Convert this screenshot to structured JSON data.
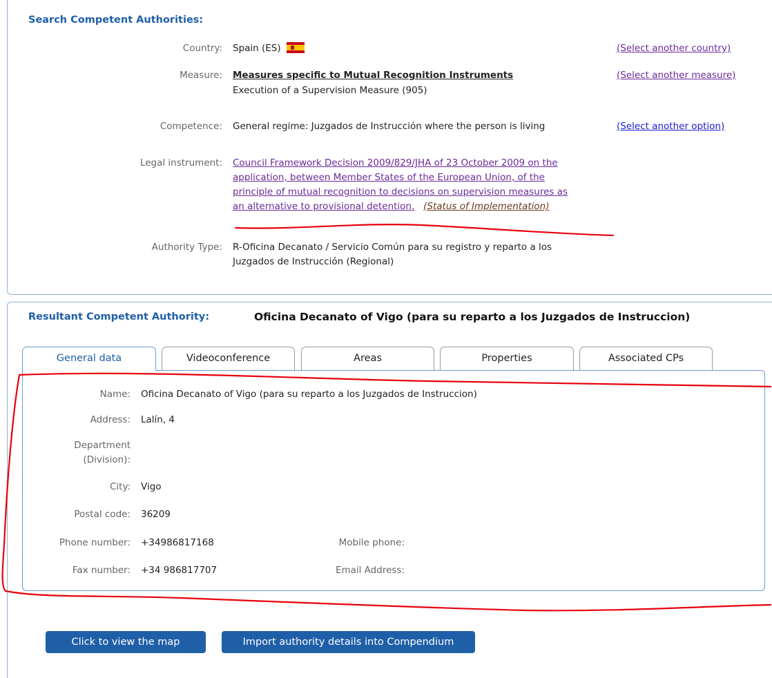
{
  "search": {
    "title": "Search Competent Authorities:",
    "country_label": "Country:",
    "country_value": "Spain (ES)",
    "country_link": "(Select another country)",
    "measure_label": "Measure:",
    "measure_title": "Measures specific to Mutual Recognition Instruments",
    "measure_sub": "Execution of a Supervision Measure (905)",
    "measure_link": "(Select another measure)",
    "competence_label": "Competence:",
    "competence_value": "General regime: Juzgados de Instrucción where the person is living",
    "competence_link": "(Select another option)",
    "legal_label": "Legal instrument:",
    "legal_lines": [
      "Council Framework Decision 2009/829/JHA of 23 October 2009 on the",
      "application, between Member States of the European Union, of the",
      "principle of mutual recognition to decisions on supervision measures as",
      "an alternative to provisional detention."
    ],
    "legal_status": "(Status of Implementation)",
    "authority_label": "Authority Type:",
    "authority_lines": [
      "R-Oficina Decanato / Servicio Común para su registro y reparto a los",
      "Juzgados de Instrucción (Regional)"
    ]
  },
  "result": {
    "title": "Resultant Competent Authority:",
    "authority_name": "Oficina Decanato of Vigo (para su reparto a los Juzgados de Instruccion)",
    "tabs": [
      "General data",
      "Videoconference",
      "Areas",
      "Properties",
      "Associated CPs"
    ],
    "fields": {
      "name_label": "Name:",
      "name_value": "Oficina Decanato of Vigo (para su reparto a los Juzgados de Instruccion)",
      "address_label": "Address:",
      "address_value": "Lalín, 4",
      "department_label_1": "Department",
      "department_label_2": "(Division):",
      "city_label": "City:",
      "city_value": "Vigo",
      "postal_label": "Postal code:",
      "postal_value": "36209",
      "phone_label": "Phone number:",
      "phone_value": "+34986817168",
      "mobile_label": "Mobile phone:",
      "fax_label": "Fax number:",
      "fax_value": "+34 986817707",
      "email_label": "Email Address:"
    }
  },
  "buttons": {
    "map": "Click to view the map",
    "import": "Import authority details into Compendium"
  },
  "colors": {
    "accent": "#1f5fa8",
    "annotation": "#e8000b"
  },
  "icons": {
    "country_flag": "spain-flag-icon"
  }
}
